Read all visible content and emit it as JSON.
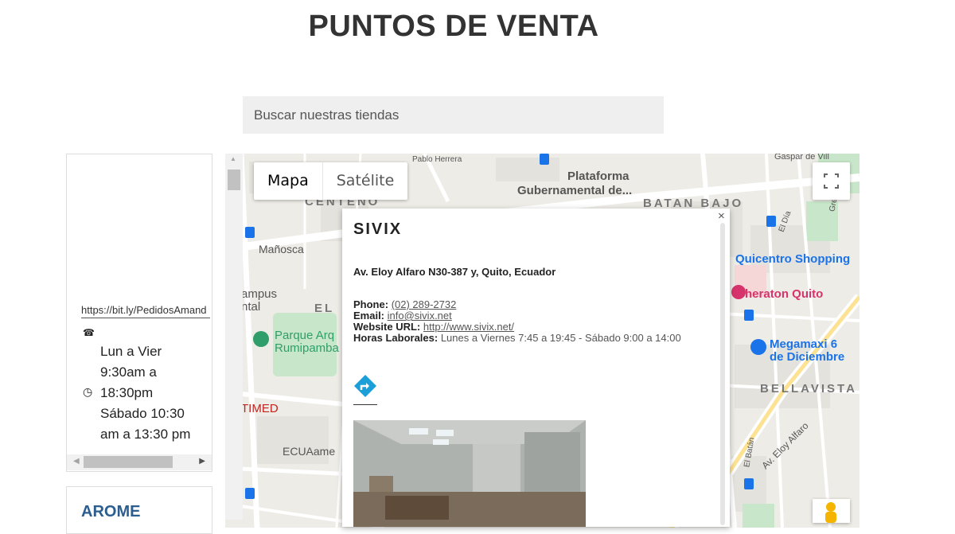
{
  "page": {
    "title": "PUNTOS DE VENTA"
  },
  "search": {
    "placeholder": "Buscar nuestras tiendas"
  },
  "sidebar": {
    "store1": {
      "link": "https://bit.ly/PedidosAmand",
      "hours_lines": [
        "Lun a Vier",
        "9:30am a",
        "18:30pm",
        "Sábado 10:30",
        "am a 13:30 pm"
      ]
    },
    "store2": {
      "name": "AROME"
    }
  },
  "map": {
    "type_buttons": {
      "map": "Mapa",
      "satellite": "Satélite"
    },
    "labels": {
      "plataforma": "Plataforma",
      "gubernamental": "Gubernamental de...",
      "centeno": "CENTENO",
      "batan_bajo": "BATAN BAJO",
      "manosca": "Mañosca",
      "campus": "ampus",
      "ntal": "ntal",
      "el": "EL",
      "parque1": "Parque Arq",
      "parque2": "Rumipamba",
      "quicentro": "Quicentro Shopping",
      "sheraton": "Sheraton Quito",
      "megamaxi1": "Megamaxi 6",
      "megamaxi2": "de Diciembre",
      "bellavista": "BELLAVISTA",
      "timed": "TIMED",
      "ecuaame": "ECUAame",
      "eloy_alfaro": "Av. Eloy Alfaro",
      "el_batan": "El Batán",
      "gaspar": "Gaspar de Vill",
      "pablo_herrera": "Pablo Herrera",
      "el_dia": "El Día",
      "gregorio": "Gregorio Mu"
    },
    "colors": {
      "poi_blue": "#1a73e8",
      "poi_red": "#d6336c",
      "park": "#c8e6c9"
    }
  },
  "info_window": {
    "name": "SIVIX",
    "address": "Av. Eloy Alfaro N30-387 y, Quito, Ecuador",
    "phone_label": "Phone:",
    "phone": "(02) 289-2732",
    "email_label": "Email:",
    "email": "info@sivix.net",
    "website_label": "Website URL:",
    "website": "http://www.sivix.net/",
    "hours_label": "Horas Laborales:",
    "hours": "Lunes a Viernes 7:45 a 19:45 - Sábado 9:00 a 14:00",
    "close": "×"
  }
}
